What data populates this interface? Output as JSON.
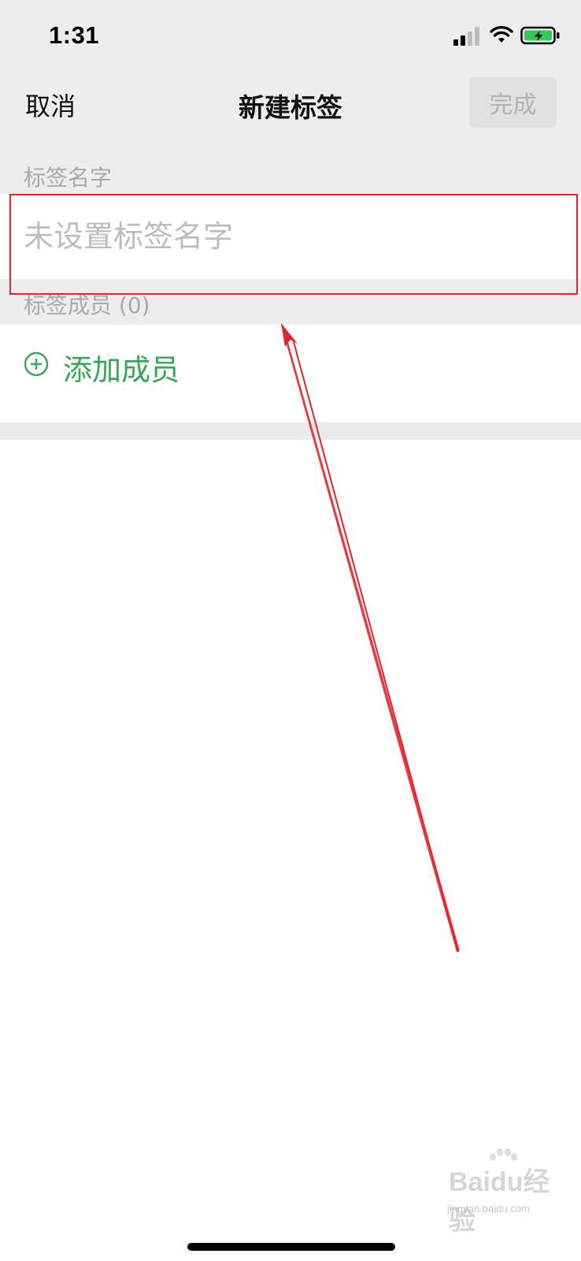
{
  "status_bar": {
    "time": "1:31",
    "icons": [
      "signal-icon",
      "wifi-icon",
      "battery-charging-icon"
    ]
  },
  "nav": {
    "cancel_label": "取消",
    "title": "新建标签",
    "done_label": "完成"
  },
  "form": {
    "name_section_label": "标签名字",
    "name_placeholder": "未设置标签名字",
    "name_value": "",
    "members_section_label": "标签成员 (0)",
    "add_member_label": "添加成员"
  },
  "annotation": {
    "highlight_color": "#e4232b",
    "arrow_color": "#e4232b"
  },
  "watermark": {
    "brand": "Baidu经验",
    "url": "jingyan.baidu.com"
  },
  "colors": {
    "accent_green": "#34a853",
    "header_background": "#ededed"
  }
}
